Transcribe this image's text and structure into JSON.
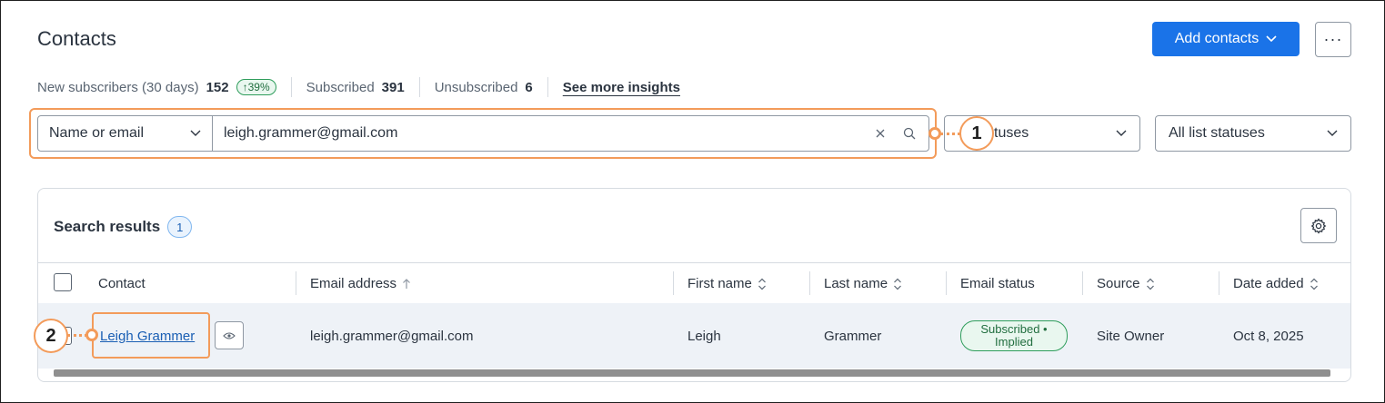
{
  "page": {
    "title": "Contacts"
  },
  "header": {
    "add_contacts_label": "Add contacts",
    "more_label": "···"
  },
  "stats": {
    "new_subscribers_label": "New subscribers (30 days)",
    "new_subscribers_value": "152",
    "new_subscribers_change": "↑39%",
    "subscribed_label": "Subscribed",
    "subscribed_value": "391",
    "unsubscribed_label": "Unsubscribed",
    "unsubscribed_value": "6",
    "insights_link": "See more insights"
  },
  "search": {
    "field_type": "Name or email",
    "value": "leigh.grammer@gmail.com"
  },
  "filters": {
    "status_visible": "tuses",
    "list_status": "All list statuses"
  },
  "results": {
    "title": "Search results",
    "count": "1",
    "columns": [
      "Contact",
      "Email address",
      "First name",
      "Last name",
      "Email status",
      "Source",
      "Date added"
    ],
    "rows": [
      {
        "contact": "Leigh Grammer",
        "email": "leigh.grammer@gmail.com",
        "first_name": "Leigh",
        "last_name": "Grammer",
        "email_status": "Subscribed • Implied",
        "source": "Site Owner",
        "date_added": "Oct 8, 2025"
      }
    ]
  },
  "callouts": {
    "one": "1",
    "two": "2"
  },
  "colors": {
    "primary": "#1a73e8",
    "highlight": "#f39b5a",
    "success": "#2e9d5b"
  }
}
